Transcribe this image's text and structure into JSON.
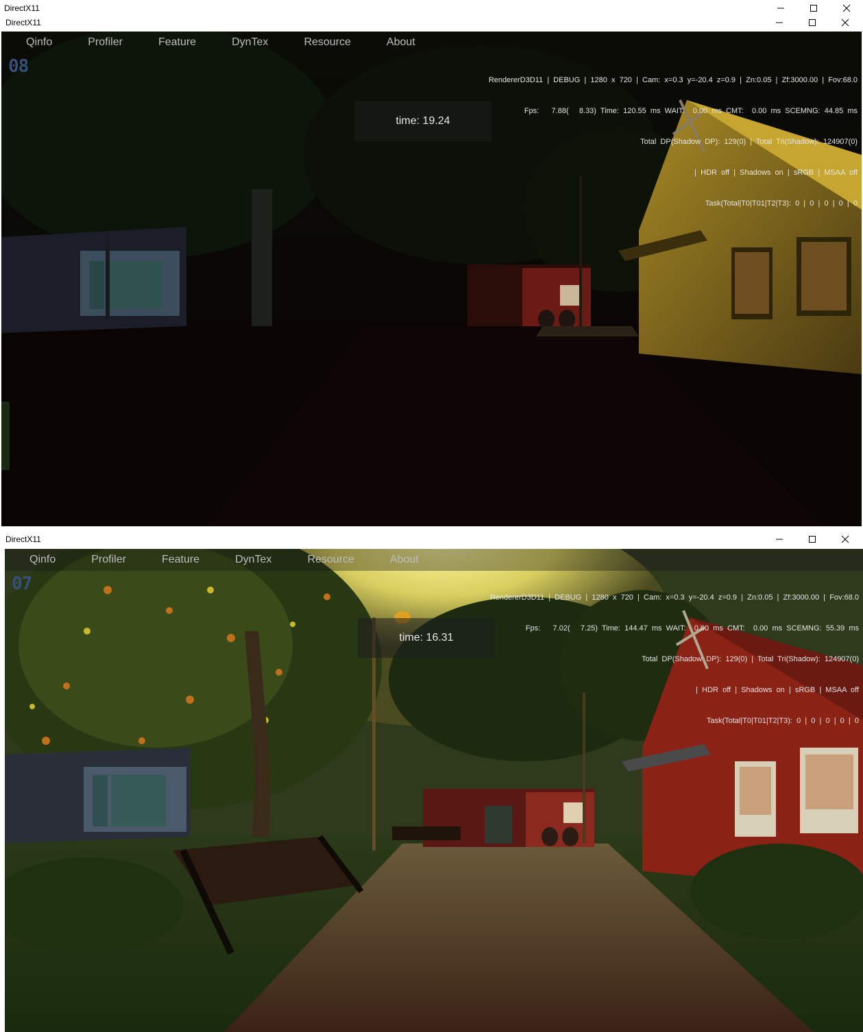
{
  "outer_window": {
    "title": "DirectX11"
  },
  "top_window": {
    "title": "DirectX11",
    "menu": [
      "Qinfo",
      "Profiler",
      "Feature",
      "DynTex",
      "Resource",
      "About"
    ],
    "frame_number": "08",
    "stats": {
      "line1": "RendererD3D11  |  DEBUG  |  1280  x  720  |  Cam:  x=0.3  y=-20.4  z=0.9  |  Zn:0.05  |  Zf:3000.00  |  Fov:68.0",
      "line2": "Fps:      7.88(     8.33)  Time:  120.55  ms  WAIT:    0.00  ms  CMT:    0.00  ms  SCEMNG:  44.85  ms",
      "line3": "Total  DP(Shadow  DP):  129(0)  |  Total  Tri(Shadow):  124907(0)",
      "line4": "|  HDR  off  |  Shadows  on  |  sRGB  |  MSAA  off",
      "line5": "Task(Total|T0|T01|T2|T3):  0  |  0  |  0  |  0  |  0"
    },
    "time_label": "time:  19.24"
  },
  "bottom_window": {
    "title": "DirectX11",
    "menu": [
      "Qinfo",
      "Profiler",
      "Feature",
      "DynTex",
      "Resource",
      "About"
    ],
    "frame_number": "07",
    "stats": {
      "line1": "RendererD3D11  |  DEBUG  |  1280  x  720  |  Cam:  x=0.3  y=-20.4  z=0.9  |  Zn:0.05  |  Zf:3000.00  |  Fov:68.0",
      "line2": "Fps:      7.02(     7.25)  Time:  144.47  ms  WAIT:    0.00  ms  CMT:    0.00  ms  SCEMNG:  55.39  ms",
      "line3": "Total  DP(Shadow  DP):  129(0)  |  Total  Tri(Shadow):  124907(0)",
      "line4": "|  HDR  off  |  Shadows  on  |  sRGB  |  MSAA  off",
      "line5": "Task(Total|T0|T01|T2|T3):  0  |  0  |  0  |  0  |  0"
    },
    "time_label": "time:  16.31"
  }
}
